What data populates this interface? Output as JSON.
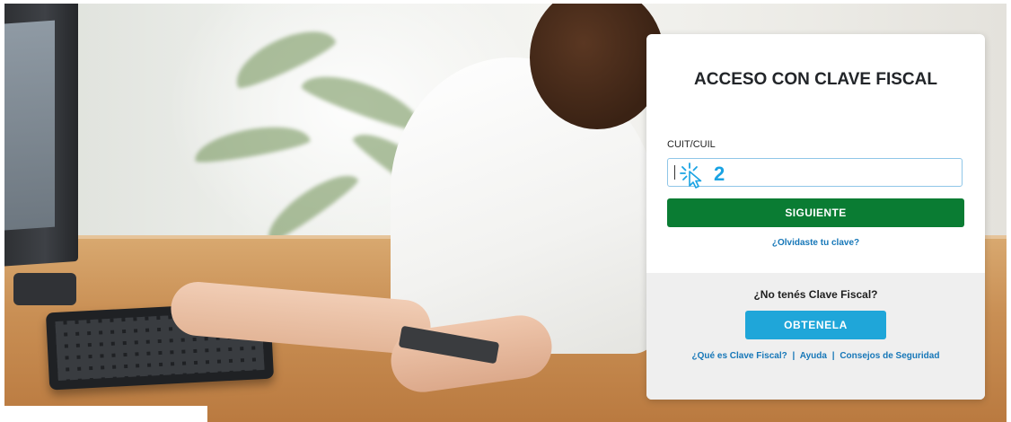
{
  "login": {
    "title": "ACCESO CON CLAVE FISCAL",
    "field_label": "CUIT/CUIL",
    "input_value": "",
    "submit_label": "SIGUIENTE",
    "forgot_link": "¿Olvidaste tu clave?"
  },
  "annotation": {
    "step_number": "2",
    "icon": "click-pointer-icon"
  },
  "register": {
    "question": "¿No tenés Clave Fiscal?",
    "button_label": "OBTENELA",
    "links": [
      "¿Qué es Clave Fiscal?",
      "Ayuda",
      "Consejos de Seguridad"
    ],
    "separator": "|"
  },
  "colors": {
    "submit_green": "#0a7c33",
    "obtenela_blue": "#1fa6d9",
    "link_blue": "#1677b8",
    "input_border": "#8fc6e8",
    "annotation_blue": "#1aa3e3"
  }
}
